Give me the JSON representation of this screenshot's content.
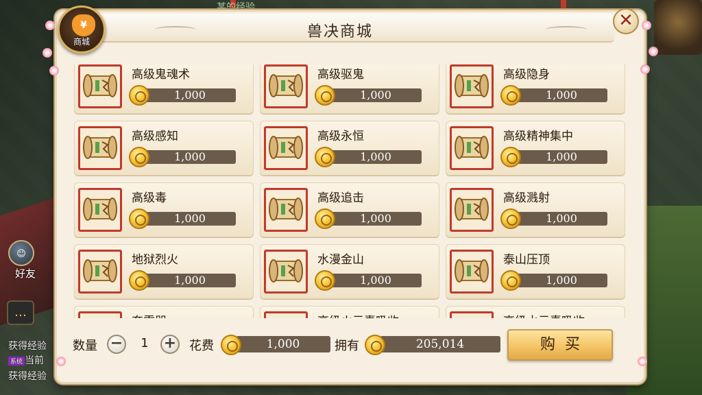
{
  "window": {
    "title": "兽决商城",
    "badge_label": "商城",
    "badge_symbol": "¥",
    "close_glyph": "✕"
  },
  "background": {
    "friends_label": "好友",
    "chat_glyph": "…",
    "top_text": "某的经验…",
    "log_lines": [
      {
        "text": "获得经验",
        "tag": ""
      },
      {
        "text": "当前",
        "tag": "系统"
      },
      {
        "text": "获得经验",
        "tag": ""
      }
    ]
  },
  "items": [
    {
      "name": "高级鬼魂术",
      "price": "1,000"
    },
    {
      "name": "高级驱鬼",
      "price": "1,000"
    },
    {
      "name": "高级隐身",
      "price": "1,000"
    },
    {
      "name": "高级感知",
      "price": "1,000"
    },
    {
      "name": "高级永恒",
      "price": "1,000"
    },
    {
      "name": "高级精神集中",
      "price": "1,000"
    },
    {
      "name": "高级毒",
      "price": "1,000"
    },
    {
      "name": "高级追击",
      "price": "1,000"
    },
    {
      "name": "高级溅射",
      "price": "1,000"
    },
    {
      "name": "地狱烈火",
      "price": "1,000"
    },
    {
      "name": "水漫金山",
      "price": "1,000"
    },
    {
      "name": "泰山压顶",
      "price": "1,000"
    },
    {
      "name": "奔雷咒",
      "price": ""
    },
    {
      "name": "高级火元素吸收",
      "price": ""
    },
    {
      "name": "高级水元素吸收",
      "price": ""
    }
  ],
  "purchase": {
    "quantity_label": "数量",
    "quantity_value": "1",
    "minus_glyph": "−",
    "plus_glyph": "+",
    "cost_label": "花费",
    "cost_value": "1,000",
    "owned_label": "拥有",
    "owned_value": "205,014",
    "buy_label": "购买"
  },
  "colors": {
    "panel_bg": "#f6efe2",
    "icon_border": "#c03a2b",
    "price_bar": "#6b5b4a",
    "buy_button": "#f3c566"
  }
}
